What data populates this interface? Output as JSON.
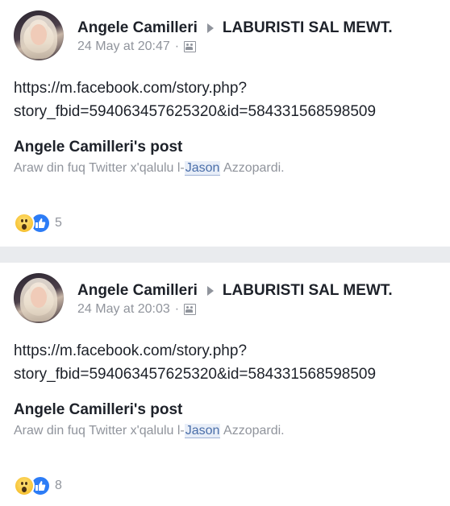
{
  "posts": [
    {
      "author": "Angele Camilleri",
      "group": "LABURISTI SAL MEWT.",
      "timestamp": "24 May at 20:47",
      "link_line1": "https://m.facebook.com/story.php?",
      "link_line2": "story_fbid=594063457625320&id=584331568598509",
      "shared_title": "Angele Camilleri's post",
      "shared_text_before": "Araw din fuq Twitter x'qalulu l-",
      "shared_text_highlight": "Jason",
      "shared_text_after": " Azzopardi.",
      "reaction_count": "5"
    },
    {
      "author": "Angele Camilleri",
      "group": "LABURISTI SAL MEWT.",
      "timestamp": "24 May at 20:03",
      "link_line1": "https://m.facebook.com/story.php?",
      "link_line2": "story_fbid=594063457625320&id=584331568598509",
      "shared_title": "Angele Camilleri's post",
      "shared_text_before": "Araw din fuq Twitter x'qalulu l-",
      "shared_text_highlight": "Jason",
      "shared_text_after": " Azzopardi.",
      "reaction_count": "8"
    }
  ],
  "separator": "·",
  "icons": {
    "privacy": "group-members-icon",
    "reaction_1": "wow-reaction-icon",
    "reaction_2": "like-reaction-icon",
    "arrow": "triangle-right-icon"
  },
  "colors": {
    "text": "#1d2129",
    "secondary": "#90949c",
    "like_blue": "#2c7cf6",
    "divider": "#e9ebee"
  }
}
